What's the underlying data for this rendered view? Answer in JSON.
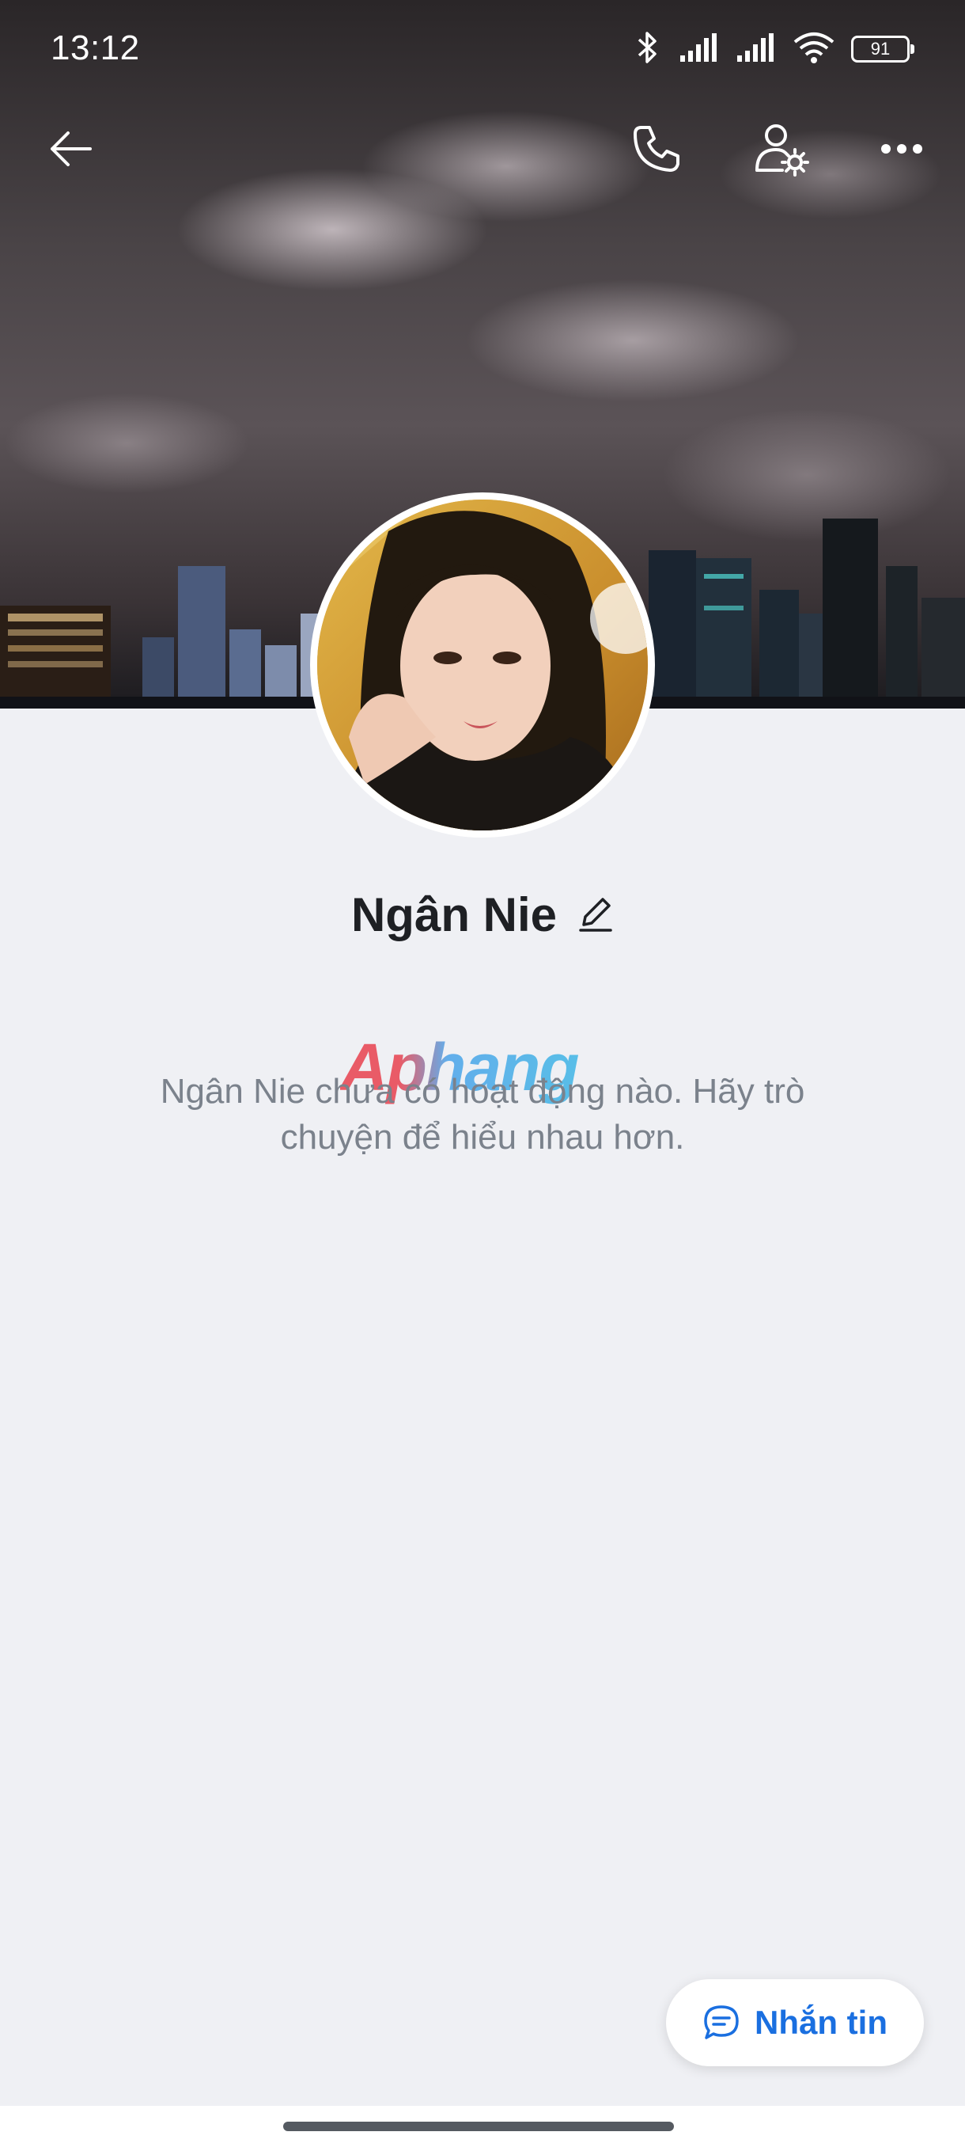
{
  "status_bar": {
    "time": "13:12",
    "battery": "91",
    "icons": [
      "bluetooth-icon",
      "signal-icon",
      "signal-icon",
      "wifi-icon",
      "battery-icon"
    ]
  },
  "top_nav": {
    "icons": [
      "back-arrow-icon",
      "phone-icon",
      "user-settings-icon",
      "more-icon"
    ]
  },
  "profile": {
    "name": "Ngân Nie",
    "edit_icon": "pencil-icon",
    "empty_message": "Ngân Nie chưa có hoạt động nào. Hãy trò chuyện để hiểu nhau hơn."
  },
  "watermark": {
    "text": "Aphang"
  },
  "actions": {
    "message_label": "Nhắn tin",
    "message_icon": "chat-bubble-icon",
    "accent_color": "#1a6fe0"
  },
  "colors": {
    "background": "#eff0f4",
    "text_primary": "#1e2024",
    "text_secondary": "#7b828c"
  }
}
